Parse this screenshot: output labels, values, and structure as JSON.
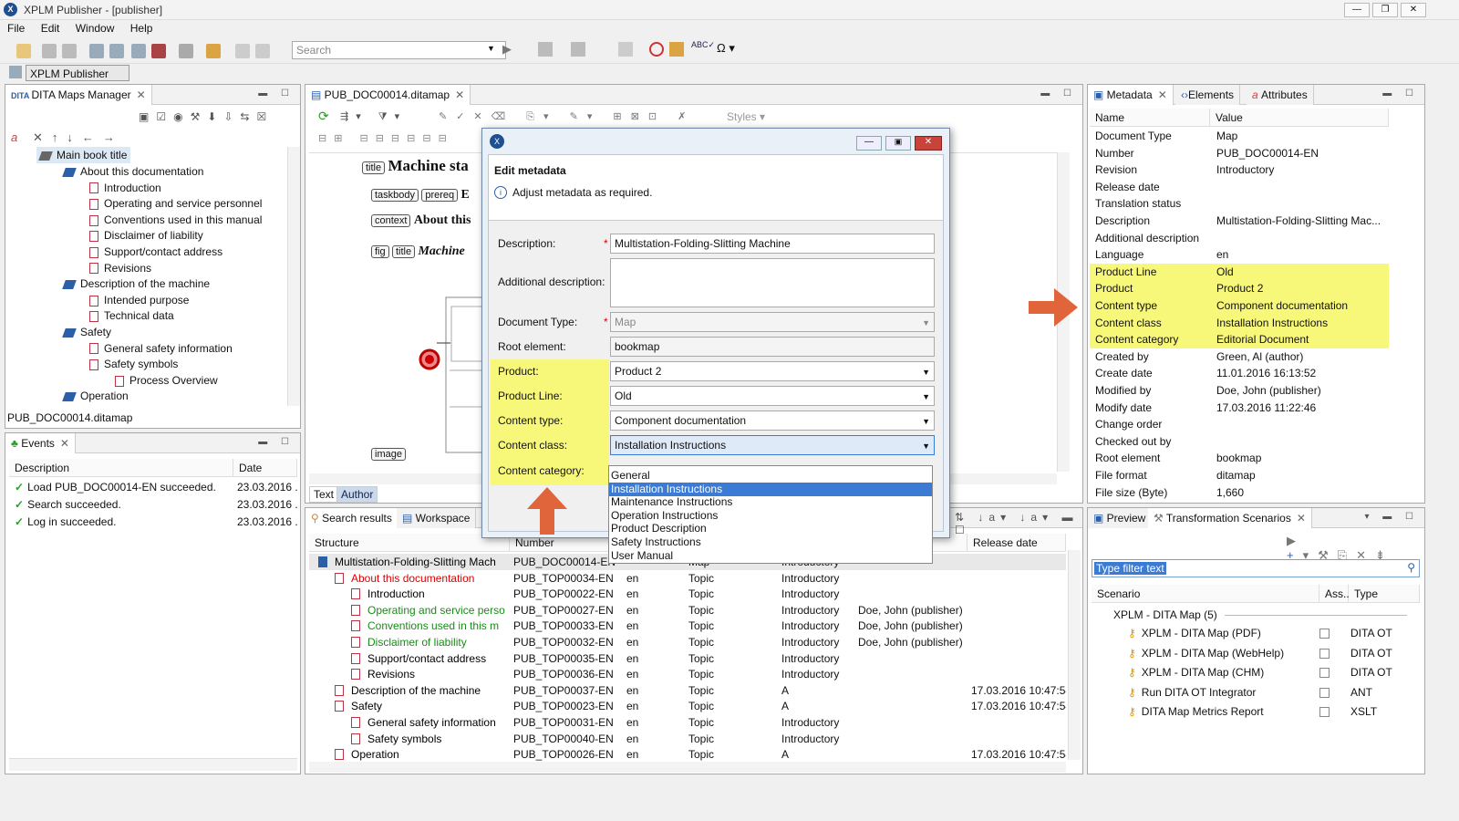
{
  "window": {
    "title": "XPLM Publisher - [publisher]"
  },
  "menu": [
    "File",
    "Edit",
    "Window",
    "Help"
  ],
  "toolbar": {
    "search_placeholder": "Search",
    "styles_label": "Styles"
  },
  "perspective": {
    "label": "XPLM Publisher"
  },
  "dita_maps": {
    "tab": "DITA Maps Manager",
    "root": "Main book title",
    "items": [
      {
        "label": "About this documentation",
        "level": 1,
        "type": "book"
      },
      {
        "label": "Introduction",
        "level": 2,
        "type": "topic"
      },
      {
        "label": "Operating and service personnel",
        "level": 2,
        "type": "topic"
      },
      {
        "label": "Conventions used in this manual",
        "level": 2,
        "type": "topic"
      },
      {
        "label": "Disclaimer of liability",
        "level": 2,
        "type": "topic"
      },
      {
        "label": "Support/contact address",
        "level": 2,
        "type": "topic"
      },
      {
        "label": "Revisions",
        "level": 2,
        "type": "topic"
      },
      {
        "label": "Description of the machine",
        "level": 1,
        "type": "book"
      },
      {
        "label": "Intended purpose",
        "level": 2,
        "type": "topic"
      },
      {
        "label": "Technical data",
        "level": 2,
        "type": "topic"
      },
      {
        "label": "Safety",
        "level": 1,
        "type": "book"
      },
      {
        "label": "General safety information",
        "level": 2,
        "type": "topic"
      },
      {
        "label": "Safety symbols",
        "level": 2,
        "type": "topic"
      },
      {
        "label": "Process Overview",
        "level": 3,
        "type": "topic"
      },
      {
        "label": "Operation",
        "level": 1,
        "type": "book"
      }
    ],
    "footer": "PUB_DOC00014.ditamap"
  },
  "events": {
    "tab": "Events",
    "headers": [
      "Description",
      "Date"
    ],
    "rows": [
      {
        "desc": "Load PUB_DOC00014-EN succeeded.",
        "date": "23.03.2016 ..."
      },
      {
        "desc": "Search succeeded.",
        "date": "23.03.2016 ..."
      },
      {
        "desc": "Log in succeeded.",
        "date": "23.03.2016 ..."
      }
    ]
  },
  "editor": {
    "tab": "PUB_DOC00014.ditamap",
    "styles": "Styles",
    "tags": {
      "title": "title",
      "taskbody": "taskbody",
      "prereq": "prereq",
      "context": "context",
      "fig": "fig",
      "image": "image"
    },
    "title_text": "Machine sta",
    "context_text": "About this",
    "fig_title_text": "Machine",
    "prereq_text": "E",
    "modes": [
      "Text",
      "Author"
    ]
  },
  "dialog": {
    "title": "Edit metadata",
    "info": "Adjust metadata as required.",
    "fields": {
      "description_label": "Description:",
      "description_value": "Multistation-Folding-Slitting Machine",
      "additional_label": "Additional description:",
      "doctype_label": "Document Type:",
      "doctype_value": "Map",
      "root_label": "Root element:",
      "root_value": "bookmap",
      "product_label": "Product:",
      "product_value": "Product 2",
      "productline_label": "Product Line:",
      "productline_value": "Old",
      "contenttype_label": "Content type:",
      "contenttype_value": "Component documentation",
      "contentclass_label": "Content class:",
      "contentclass_value": "Installation Instructions",
      "contentcategory_label": "Content category:"
    },
    "dropdown_options": [
      "General",
      "Installation Instructions",
      "Maintenance Instructions",
      "Operation Instructions",
      "Product Description",
      "Safety Instructions",
      "User Manual"
    ],
    "dropdown_selected": "Installation Instructions"
  },
  "metadata": {
    "tabs": [
      "Metadata",
      "Elements",
      "Attributes"
    ],
    "headers": [
      "Name",
      "Value"
    ],
    "rows": [
      {
        "name": "Document Type",
        "value": "Map",
        "hl": false
      },
      {
        "name": "Number",
        "value": "PUB_DOC00014-EN",
        "hl": false
      },
      {
        "name": "Revision",
        "value": "Introductory",
        "hl": false
      },
      {
        "name": "Release date",
        "value": "",
        "hl": false
      },
      {
        "name": "Translation status",
        "value": "",
        "hl": false
      },
      {
        "name": "Description",
        "value": "Multistation-Folding-Slitting Mac...",
        "hl": false
      },
      {
        "name": "Additional description",
        "value": "",
        "hl": false
      },
      {
        "name": "Language",
        "value": "en",
        "hl": false
      },
      {
        "name": "Product Line",
        "value": "Old",
        "hl": true
      },
      {
        "name": "Product",
        "value": "Product 2",
        "hl": true
      },
      {
        "name": "Content type",
        "value": "Component documentation",
        "hl": true
      },
      {
        "name": "Content class",
        "value": "Installation Instructions",
        "hl": true
      },
      {
        "name": "Content category",
        "value": "Editorial Document",
        "hl": true
      },
      {
        "name": "Created by",
        "value": "Green, Al (author)",
        "hl": false
      },
      {
        "name": "Create date",
        "value": "11.01.2016 16:13:52",
        "hl": false
      },
      {
        "name": "Modified by",
        "value": "Doe, John (publisher)",
        "hl": false
      },
      {
        "name": "Modify date",
        "value": "17.03.2016 11:22:46",
        "hl": false
      },
      {
        "name": "Change order",
        "value": "",
        "hl": false
      },
      {
        "name": "Checked out by",
        "value": "",
        "hl": false
      },
      {
        "name": "Root element",
        "value": "bookmap",
        "hl": false
      },
      {
        "name": "File format",
        "value": "ditamap",
        "hl": false
      },
      {
        "name": "File size (Byte)",
        "value": "1,660",
        "hl": false
      }
    ]
  },
  "search": {
    "tabs": [
      "Search results",
      "Workspace"
    ],
    "headers": [
      "Structure",
      "Number",
      "",
      "",
      "",
      "",
      "Release date"
    ],
    "rows": [
      {
        "s": "Multistation-Folding-Slitting Mach",
        "n": "PUB_DOC00014-EN",
        "l": "",
        "t": "Map",
        "r": "Introductory",
        "m": "",
        "d": "",
        "lv": 0,
        "c": "#000"
      },
      {
        "s": "About this documentation",
        "n": "PUB_TOP00034-EN",
        "l": "en",
        "t": "Topic",
        "r": "Introductory",
        "m": "",
        "d": "",
        "lv": 1,
        "c": "#d00"
      },
      {
        "s": "Introduction",
        "n": "PUB_TOP00022-EN",
        "l": "en",
        "t": "Topic",
        "r": "Introductory",
        "m": "",
        "d": "",
        "lv": 2,
        "c": "#000"
      },
      {
        "s": "Operating and service perso",
        "n": "PUB_TOP00027-EN",
        "l": "en",
        "t": "Topic",
        "r": "Introductory",
        "m": "Doe, John (publisher)",
        "d": "",
        "lv": 2,
        "c": "#1a8a1a"
      },
      {
        "s": "Conventions used in this m",
        "n": "PUB_TOP00033-EN",
        "l": "en",
        "t": "Topic",
        "r": "Introductory",
        "m": "Doe, John (publisher)",
        "d": "",
        "lv": 2,
        "c": "#1a8a1a"
      },
      {
        "s": "Disclaimer of liability",
        "n": "PUB_TOP00032-EN",
        "l": "en",
        "t": "Topic",
        "r": "Introductory",
        "m": "Doe, John (publisher)",
        "d": "",
        "lv": 2,
        "c": "#1a8a1a"
      },
      {
        "s": "Support/contact address",
        "n": "PUB_TOP00035-EN",
        "l": "en",
        "t": "Topic",
        "r": "Introductory",
        "m": "",
        "d": "",
        "lv": 2,
        "c": "#000"
      },
      {
        "s": "Revisions",
        "n": "PUB_TOP00036-EN",
        "l": "en",
        "t": "Topic",
        "r": "Introductory",
        "m": "",
        "d": "",
        "lv": 2,
        "c": "#000"
      },
      {
        "s": "Description of the machine",
        "n": "PUB_TOP00037-EN",
        "l": "en",
        "t": "Topic",
        "r": "A",
        "m": "",
        "d": "17.03.2016 10:47:54",
        "lv": 1,
        "c": "#000"
      },
      {
        "s": "Safety",
        "n": "PUB_TOP00023-EN",
        "l": "en",
        "t": "Topic",
        "r": "A",
        "m": "",
        "d": "17.03.2016 10:47:54",
        "lv": 1,
        "c": "#000"
      },
      {
        "s": "General safety information",
        "n": "PUB_TOP00031-EN",
        "l": "en",
        "t": "Topic",
        "r": "Introductory",
        "m": "",
        "d": "",
        "lv": 2,
        "c": "#000"
      },
      {
        "s": "Safety symbols",
        "n": "PUB_TOP00040-EN",
        "l": "en",
        "t": "Topic",
        "r": "Introductory",
        "m": "",
        "d": "",
        "lv": 2,
        "c": "#000"
      },
      {
        "s": "Operation",
        "n": "PUB_TOP00026-EN",
        "l": "en",
        "t": "Topic",
        "r": "A",
        "m": "",
        "d": "17.03.2016 10:47:54",
        "lv": 1,
        "c": "#000"
      }
    ]
  },
  "transform": {
    "tabs": [
      "Preview",
      "Transformation Scenarios"
    ],
    "filter_placeholder": "Type filter text",
    "headers": [
      "Scenario",
      "Ass...",
      "Type"
    ],
    "group": "XPLM - DITA Map (5)",
    "rows": [
      {
        "name": "XPLM - DITA Map (PDF)",
        "type": "DITA OT"
      },
      {
        "name": "XPLM - DITA Map (WebHelp)",
        "type": "DITA OT"
      },
      {
        "name": "XPLM - DITA Map (CHM)",
        "type": "DITA OT"
      },
      {
        "name": "Run DITA OT Integrator",
        "type": "ANT"
      },
      {
        "name": "DITA Map Metrics Report",
        "type": "XSLT"
      }
    ]
  },
  "colors": {
    "highlight": "#f7f77a",
    "arrow": "#e0653a",
    "accent": "#2b5fa8"
  }
}
